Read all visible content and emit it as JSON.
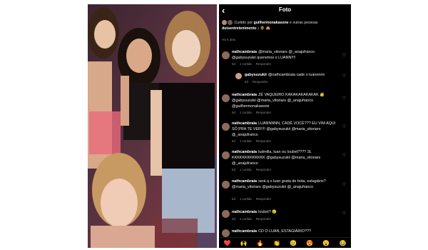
{
  "header": {
    "back_icon": "‹",
    "title": "Foto"
  },
  "liked_by": {
    "prefix": "Curtido por ",
    "user": "guilhermonakasone",
    "suffix": " e outras pessoas",
    "line2": "dutsentretenimento ♪ 🌻 🙈",
    "age": "Há 6 dias"
  },
  "comments": [
    {
      "user": "nathcambraia",
      "text": "@maria_vitoriars @_anajufranco @gabysuzukii queremos o LUANN!!!!",
      "likes": "1 curtida",
      "time": "5d",
      "reply_label": "Responder",
      "is_reply": false
    },
    {
      "user": "gabysuzukii",
      "text": "@nathcambraia cade o luannnnn",
      "likes": "",
      "time": "5d",
      "reply_label": "Responder",
      "is_reply": true
    },
    {
      "user": "nathcambraia",
      "text": "ZÉ VAQUEIRO KAKAKAKAKAKAK 🥳 @gabysuzukii @maria_vitoriars @_anajufranco @guilhermonakasone",
      "likes": "1 curtida",
      "time": "5d",
      "reply_label": "Responder",
      "is_reply": false
    },
    {
      "user": "nathcambraia",
      "text": "LUANNNNN, CADÊ VOCÊ??? EU VIM AQUI SÓ PRA TE VER!!!! @gabysuzukii @maria_vitoriars @_anajufranco",
      "likes": "1 curtida",
      "time": "5d",
      "reply_label": "Responder",
      "is_reply": false
    },
    {
      "user": "nathcambraia",
      "text": "ludmilla, luan ou loubet???? 3L KKKKKKKKKKKKK @gabysuzukii @maria_vitoriars @_anajufranco",
      "likes": "1 curtida",
      "time": "5d",
      "reply_label": "Responder",
      "is_reply": false
    },
    {
      "user": "nathcambraia",
      "text": "será q o luan gosta de bota, estagiário? @maria_vitoriars @gabysuzukii @_anajufranco",
      "likes": "1 curtida",
      "time": "5d",
      "reply_label": "Responder",
      "is_reply": false
    },
    {
      "user": "nathcambraia",
      "text": "loubet? 😢",
      "likes": "1 curtida",
      "time": "5d",
      "reply_label": "Responder",
      "is_reply": false
    },
    {
      "user": "nathcambraia",
      "text": "CD O LUAN, ESTAGIÁRIO???",
      "likes": "",
      "time": "",
      "reply_label": "",
      "is_reply": false
    }
  ],
  "emoji_bar": [
    "❤️",
    "🙌",
    "🔥",
    "👏",
    "😢",
    "😍",
    "😮",
    "😂"
  ],
  "colors": {
    "background": "#000000",
    "text": "#ffffff",
    "muted": "#8a8a8a"
  }
}
